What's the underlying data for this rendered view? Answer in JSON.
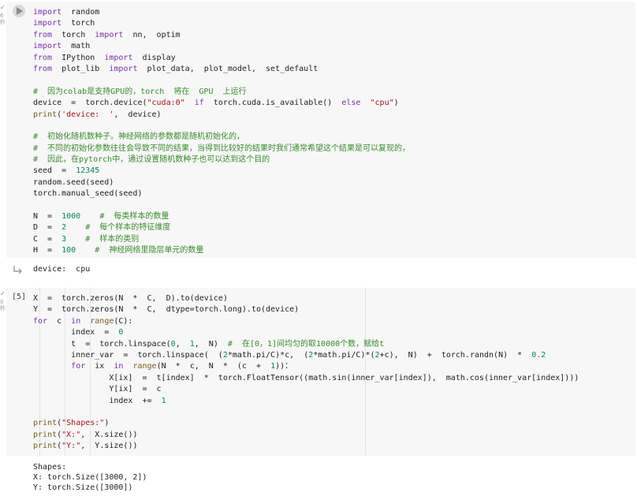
{
  "cell1": {
    "gutter_status": "✓",
    "gutter_sub": "6\n秒",
    "code_lines": [
      [
        [
          "kw",
          "import"
        ],
        [
          "t",
          "  random"
        ]
      ],
      [
        [
          "kw",
          "import"
        ],
        [
          "t",
          "  torch"
        ]
      ],
      [
        [
          "kw",
          "from"
        ],
        [
          "t",
          "  torch  "
        ],
        [
          "kw",
          "import"
        ],
        [
          "t",
          "  nn,  optim"
        ]
      ],
      [
        [
          "kw",
          "import"
        ],
        [
          "t",
          "  math"
        ]
      ],
      [
        [
          "kw",
          "from"
        ],
        [
          "t",
          "  IPython  "
        ],
        [
          "kw",
          "import"
        ],
        [
          "t",
          "  display"
        ]
      ],
      [
        [
          "kw",
          "from"
        ],
        [
          "t",
          "  plot_lib  "
        ],
        [
          "kw",
          "import"
        ],
        [
          "t",
          "  plot_data,  plot_model,  set_default"
        ]
      ],
      [
        [
          "t",
          ""
        ]
      ],
      [
        [
          "cmt",
          "#  因为colab是支持GPU的，torch  将在  GPU  上运行"
        ]
      ],
      [
        [
          "t",
          "device  =  torch.device("
        ],
        [
          "str",
          "\"cuda:0\""
        ],
        [
          "t",
          "  "
        ],
        [
          "kw",
          "if"
        ],
        [
          "t",
          "  torch.cuda.is_available()  "
        ],
        [
          "kw",
          "else"
        ],
        [
          "t",
          "  "
        ],
        [
          "str",
          "\"cpu\""
        ],
        [
          "t",
          ")"
        ]
      ],
      [
        [
          "fn",
          "print"
        ],
        [
          "t",
          "("
        ],
        [
          "str",
          "'device:  '"
        ],
        [
          "t",
          ",  device)"
        ]
      ],
      [
        [
          "t",
          ""
        ]
      ],
      [
        [
          "cmt",
          "#  初始化随机数种子。神经网络的参数都是随机初始化的，"
        ]
      ],
      [
        [
          "cmt",
          "#  不同的初始化参数往往会导致不同的结果，当得到比较好的结果时我们通常希望这个结果是可以复现的，"
        ]
      ],
      [
        [
          "cmt",
          "#  因此，在pytorch中，通过设置随机数种子也可以达到这个目的"
        ]
      ],
      [
        [
          "t",
          "seed  =  "
        ],
        [
          "num",
          "12345"
        ]
      ],
      [
        [
          "t",
          "random.seed(seed)"
        ]
      ],
      [
        [
          "t",
          "torch.manual_seed(seed)"
        ]
      ],
      [
        [
          "t",
          ""
        ]
      ],
      [
        [
          "t",
          "N  =  "
        ],
        [
          "num",
          "1000"
        ],
        [
          "t",
          "    "
        ],
        [
          "cmt",
          "#  每类样本的数量"
        ]
      ],
      [
        [
          "t",
          "D  =  "
        ],
        [
          "num",
          "2"
        ],
        [
          "t",
          "    "
        ],
        [
          "cmt",
          "#  每个样本的特征维度"
        ]
      ],
      [
        [
          "t",
          "C  =  "
        ],
        [
          "num",
          "3"
        ],
        [
          "t",
          "    "
        ],
        [
          "cmt",
          "#  样本的类别"
        ]
      ],
      [
        [
          "t",
          "H  =  "
        ],
        [
          "num",
          "100"
        ],
        [
          "t",
          "    "
        ],
        [
          "cmt",
          "#  神经网络里隐层单元的数量"
        ]
      ]
    ]
  },
  "output1": {
    "icon": "output-arrow-icon",
    "text": "device:  cpu"
  },
  "cell2": {
    "gutter_status": "✓",
    "gutter_sub": "0\n秒",
    "exec_count": "[5]",
    "code_lines": [
      [
        [
          "t",
          "X  =  torch.zeros(N  *  C,  D).to(device)"
        ]
      ],
      [
        [
          "t",
          "Y  =  torch.zeros(N  *  C,  dtype=torch.long).to(device)"
        ]
      ],
      [
        [
          "kw",
          "for"
        ],
        [
          "t",
          "  c  "
        ],
        [
          "kw",
          "in"
        ],
        [
          "t",
          "  "
        ],
        [
          "fn",
          "range"
        ],
        [
          "t",
          "(C):"
        ]
      ],
      [
        [
          "t",
          "        index  =  "
        ],
        [
          "num",
          "0"
        ]
      ],
      [
        [
          "t",
          "        t  =  torch.linspace("
        ],
        [
          "num",
          "0"
        ],
        [
          "t",
          ",  "
        ],
        [
          "num",
          "1"
        ],
        [
          "t",
          ",  N)  "
        ],
        [
          "cmt",
          "#  在[0，1]间均匀的取10000个数，赋给t"
        ]
      ],
      [
        [
          "t",
          "        inner_var  =  torch.linspace(  ("
        ],
        [
          "num",
          "2"
        ],
        [
          "t",
          "*math.pi/C)*c,  ("
        ],
        [
          "num",
          "2"
        ],
        [
          "t",
          "*math.pi/C)*("
        ],
        [
          "num",
          "2"
        ],
        [
          "t",
          "+c),  N)  +  torch.randn(N)  *  "
        ],
        [
          "num",
          "0.2"
        ]
      ],
      [
        [
          "t",
          "        "
        ],
        [
          "kw",
          "for"
        ],
        [
          "t",
          "  ix  "
        ],
        [
          "kw",
          "in"
        ],
        [
          "t",
          "  "
        ],
        [
          "fn",
          "range"
        ],
        [
          "t",
          "(N  *  c,  N  *  (c  +  "
        ],
        [
          "num",
          "1"
        ],
        [
          "t",
          "))："
        ]
      ],
      [
        [
          "t",
          "                X[ix]  =  t[index]  *  torch.FloatTensor((math.sin(inner_var[index]),  math.cos(inner_var[index])))"
        ]
      ],
      [
        [
          "t",
          "                Y[ix]  =  c"
        ]
      ],
      [
        [
          "t",
          "                index  +=  "
        ],
        [
          "num",
          "1"
        ]
      ],
      [
        [
          "t",
          ""
        ]
      ],
      [
        [
          "fn",
          "print"
        ],
        [
          "t",
          "("
        ],
        [
          "str",
          "\"Shapes:\""
        ],
        [
          "t",
          ")"
        ]
      ],
      [
        [
          "fn",
          "print"
        ],
        [
          "t",
          "("
        ],
        [
          "str",
          "\"X:\""
        ],
        [
          "t",
          ",  X.size())"
        ]
      ],
      [
        [
          "fn",
          "print"
        ],
        [
          "t",
          "("
        ],
        [
          "str",
          "\"Y:\""
        ],
        [
          "t",
          ",  Y.size())"
        ]
      ]
    ]
  },
  "output2": {
    "lines": [
      "Shapes:",
      "X: torch.Size([3000, 2])",
      "Y: torch.Size([3000])"
    ]
  }
}
